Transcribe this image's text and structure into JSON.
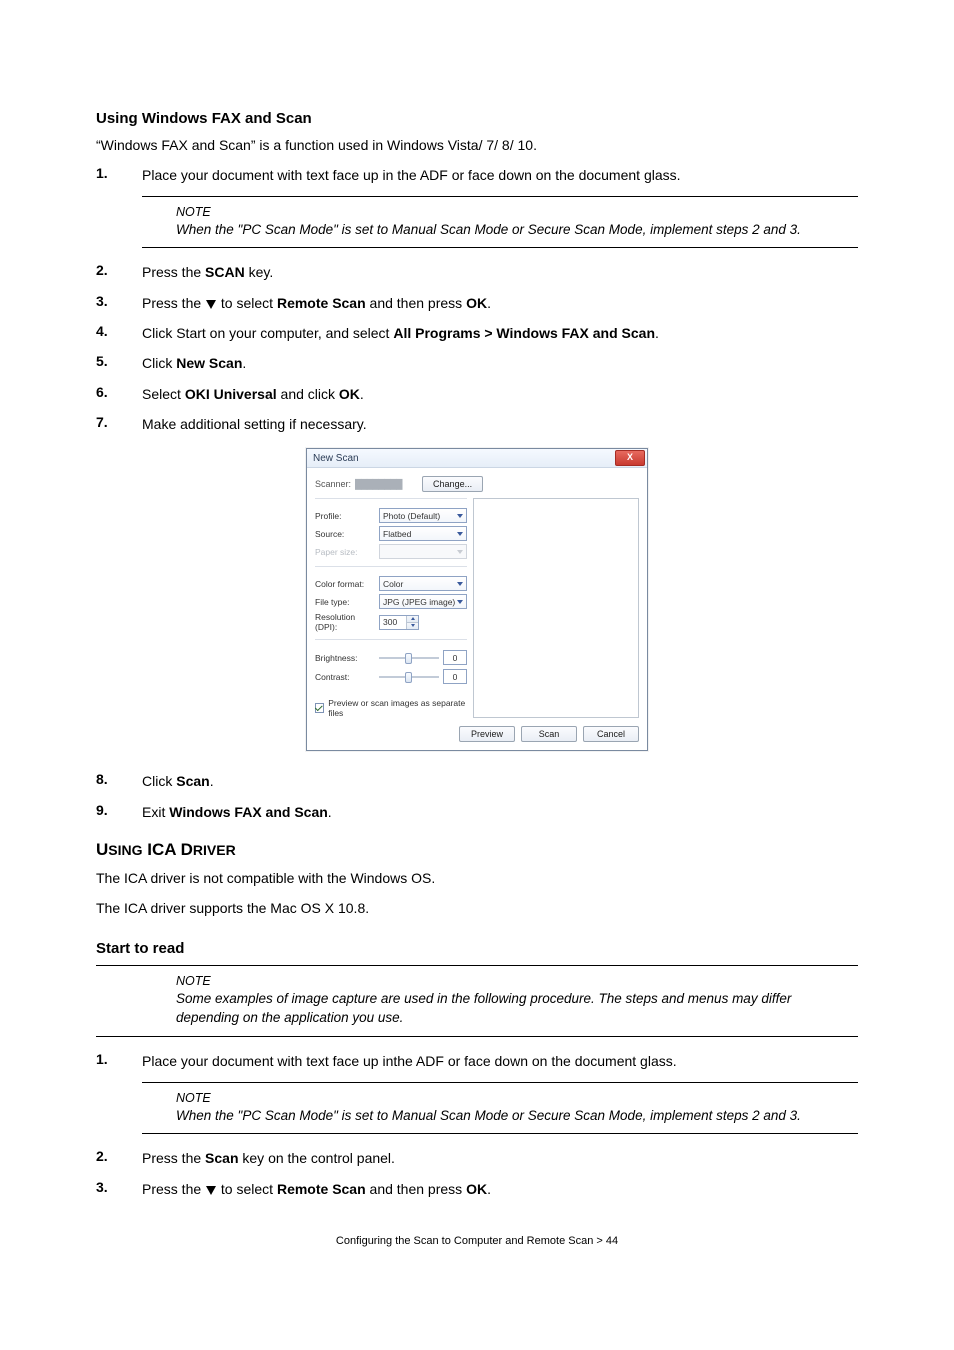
{
  "headings": {
    "sec1": "Using Windows FAX and Scan",
    "sec2_small": "Using ICA Driver",
    "sec3": "Start to read"
  },
  "p_intro_fax": "“Windows FAX and Scan” is a function used in Windows Vista/ 7/ 8/ 10.",
  "p_ica1": "The ICA driver is not compatible with the Windows OS.",
  "p_ica2": "The ICA driver supports the Mac OS X 10.8.",
  "note_label": "NOTE",
  "note_pcscan": "When the \"PC Scan Mode\" is set to Manual Scan Mode or Secure Scan Mode, implement steps 2 and 3.",
  "note_examples": "Some examples of image capture are used in the following procedure. The steps and menus may differ depending on the application you use.",
  "steps_a": {
    "1": {
      "pre": "Place your document with text face up in the ADF or face down on the document glass."
    },
    "2": {
      "pre": "Press the ",
      "b1": "SCAN",
      "post": " key."
    },
    "3": {
      "pre": "Press the ",
      "mid": " to select ",
      "b1": "Remote Scan",
      "mid2": " and then press ",
      "b2": "OK",
      "post": "."
    },
    "4": {
      "pre": "Click Start on your computer, and select ",
      "b1": "All Programs > Windows FAX and Scan",
      "post": "."
    },
    "5": {
      "pre": "Click ",
      "b1": "New Scan",
      "post": "."
    },
    "6": {
      "pre": "Select ",
      "b1": "OKI Universal",
      "mid": " and click ",
      "b2": "OK",
      "post": "."
    },
    "7": {
      "pre": "Make additional setting if necessary."
    },
    "8": {
      "pre": "Click ",
      "b1": "Scan",
      "post": "."
    },
    "9": {
      "pre": "Exit ",
      "b1": "Windows FAX and Scan",
      "post": "."
    }
  },
  "steps_b": {
    "1": {
      "pre": "Place your document with text face up inthe ADF or face down on the document glass."
    },
    "2": {
      "pre": "Press the ",
      "b1": "Scan",
      "post": " key on the control panel."
    },
    "3": {
      "pre": "Press the ",
      "mid": " to select ",
      "b1": "Remote Scan",
      "mid2": " and then press ",
      "b2": "OK",
      "post": "."
    }
  },
  "dialog": {
    "title": "New Scan",
    "scanner_label": "Scanner:",
    "scanner_name": "████████",
    "change_btn": "Change...",
    "profile_label": "Profile:",
    "profile_value": "Photo (Default)",
    "source_label": "Source:",
    "source_value": "Flatbed",
    "paper_label": "Paper size:",
    "paper_value": "",
    "color_label": "Color format:",
    "color_value": "Color",
    "file_label": "File type:",
    "file_value": "JPG (JPEG image)",
    "res_label": "Resolution (DPI):",
    "res_value": "300",
    "bright_label": "Brightness:",
    "bright_value": "0",
    "contrast_label": "Contrast:",
    "contrast_value": "0",
    "checkbox": "Preview or scan images as separate files",
    "btn_preview": "Preview",
    "btn_scan": "Scan",
    "btn_cancel": "Cancel"
  },
  "footer": "Configuring the Scan to Computer and Remote Scan > 44"
}
